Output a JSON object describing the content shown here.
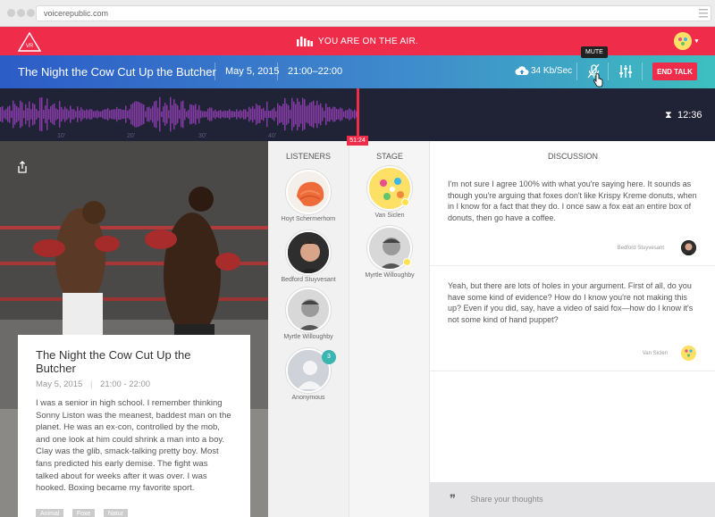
{
  "browser": {
    "url": "voicerepublic.com"
  },
  "topbar": {
    "logo_text": "VR",
    "status": "YOU ARE ON THE AIR."
  },
  "talk": {
    "title": "The Night the Cow Cut Up the Butcher",
    "date": "May 5, 2015",
    "time": "21:00–22:00",
    "upload_rate": "34 Kb/Sec",
    "mute_tooltip": "MUTE",
    "end_label": "END TALK"
  },
  "waveform": {
    "ticks": [
      "10'",
      "20'",
      "30'",
      "40'"
    ],
    "live_position": "51:24",
    "remaining": "12:36",
    "played_color": "#ef2d4a",
    "start_color": "#2c5cc7"
  },
  "card": {
    "title": "The Night the Cow Cut Up the Butcher",
    "date": "May 5, 2015",
    "time": "21:00 - 22:00",
    "description": "I was a senior in high school. I remember thinking Sonny Liston was the meanest, baddest man on the planet. He was an ex-con, controlled by the mob, and one look at him could shrink a man into a boy. Clay was the glib, smack-talking pretty boy. Most fans predicted his early demise. The fight was talked about for weeks after it was over. I was hooked. Boxing became my favorite sport.",
    "tags": [
      "Animal",
      "Foxe",
      "Natur"
    ]
  },
  "listeners": {
    "heading": "LISTENERS",
    "people": [
      {
        "name": "Hoyt Schermerhorn"
      },
      {
        "name": "Bedford Stuyvesant"
      },
      {
        "name": "Myrtle Willoughby"
      },
      {
        "name": "Anonymous",
        "count": "3"
      }
    ]
  },
  "stage": {
    "heading": "STAGE",
    "people": [
      {
        "name": "Van Siclen"
      },
      {
        "name": "Myrtle Willoughby"
      }
    ]
  },
  "discussion": {
    "heading": "DISCUSSION",
    "messages": [
      {
        "text": "I'm not sure I agree 100% with what you're saying here. It sounds as though you're arguing that foxes don't like Krispy Kreme donuts, when in I know for a fact that they do. I once saw a fox eat an entire box of donuts, then go have a coffee.",
        "author": "Bedford Stuyvesant"
      },
      {
        "text": "Yeah, but there are lots of holes in your argument. First of all, do you have some kind of evidence? How do I know you're not making this up? Even if you did, say, have a video of said fox—how do I know it's not some kind of hand puppet?",
        "author": "Van Siclen"
      }
    ],
    "composer_placeholder": "Share your thoughts"
  }
}
